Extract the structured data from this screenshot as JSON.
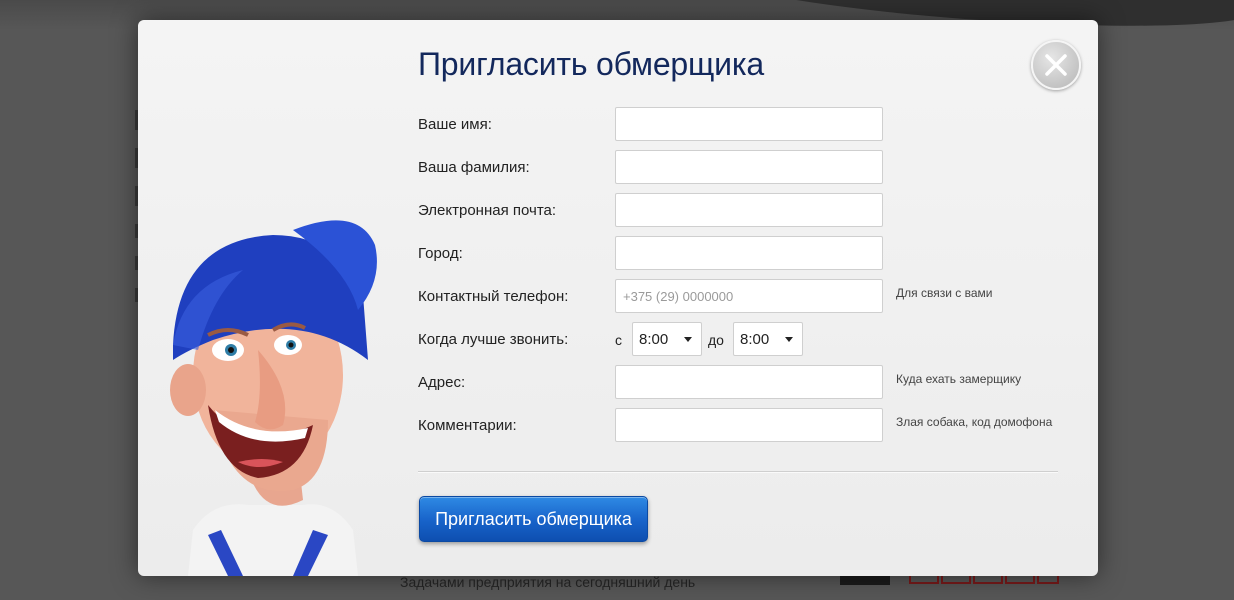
{
  "background": {
    "footer_text": "Задачами предприятия на сегодняшний день"
  },
  "modal": {
    "title": "Пригласить обмерщика",
    "close_icon": "close-icon",
    "mascot_icon": "mascot-illustration",
    "fields": [
      {
        "label": "Ваше имя:",
        "value": "",
        "placeholder": "",
        "hint": ""
      },
      {
        "label": "Ваша фамилия:",
        "value": "",
        "placeholder": "",
        "hint": ""
      },
      {
        "label": "Электронная почта:",
        "value": "",
        "placeholder": "",
        "hint": ""
      },
      {
        "label": "Город:",
        "value": "",
        "placeholder": "",
        "hint": ""
      },
      {
        "label": "Контактный телефон:",
        "value": "",
        "placeholder": "+375 (29) 0000000",
        "hint": "Для связи с вами"
      },
      {
        "label": "Адрес:",
        "value": "",
        "placeholder": "",
        "hint": "Куда ехать замерщику"
      },
      {
        "label": "Комментарии:",
        "value": "",
        "placeholder": "",
        "hint": "Злая собака, код домофона"
      }
    ],
    "call_time": {
      "label": "Когда лучше звонить:",
      "from_prefix": "с",
      "from_value": "8:00",
      "to_prefix": "до",
      "to_value": "8:00"
    },
    "submit_label": "Пригласить обмерщика",
    "colors": {
      "title": "#13285c",
      "button": "#1762c9",
      "cap": "#1f3fbf"
    }
  }
}
